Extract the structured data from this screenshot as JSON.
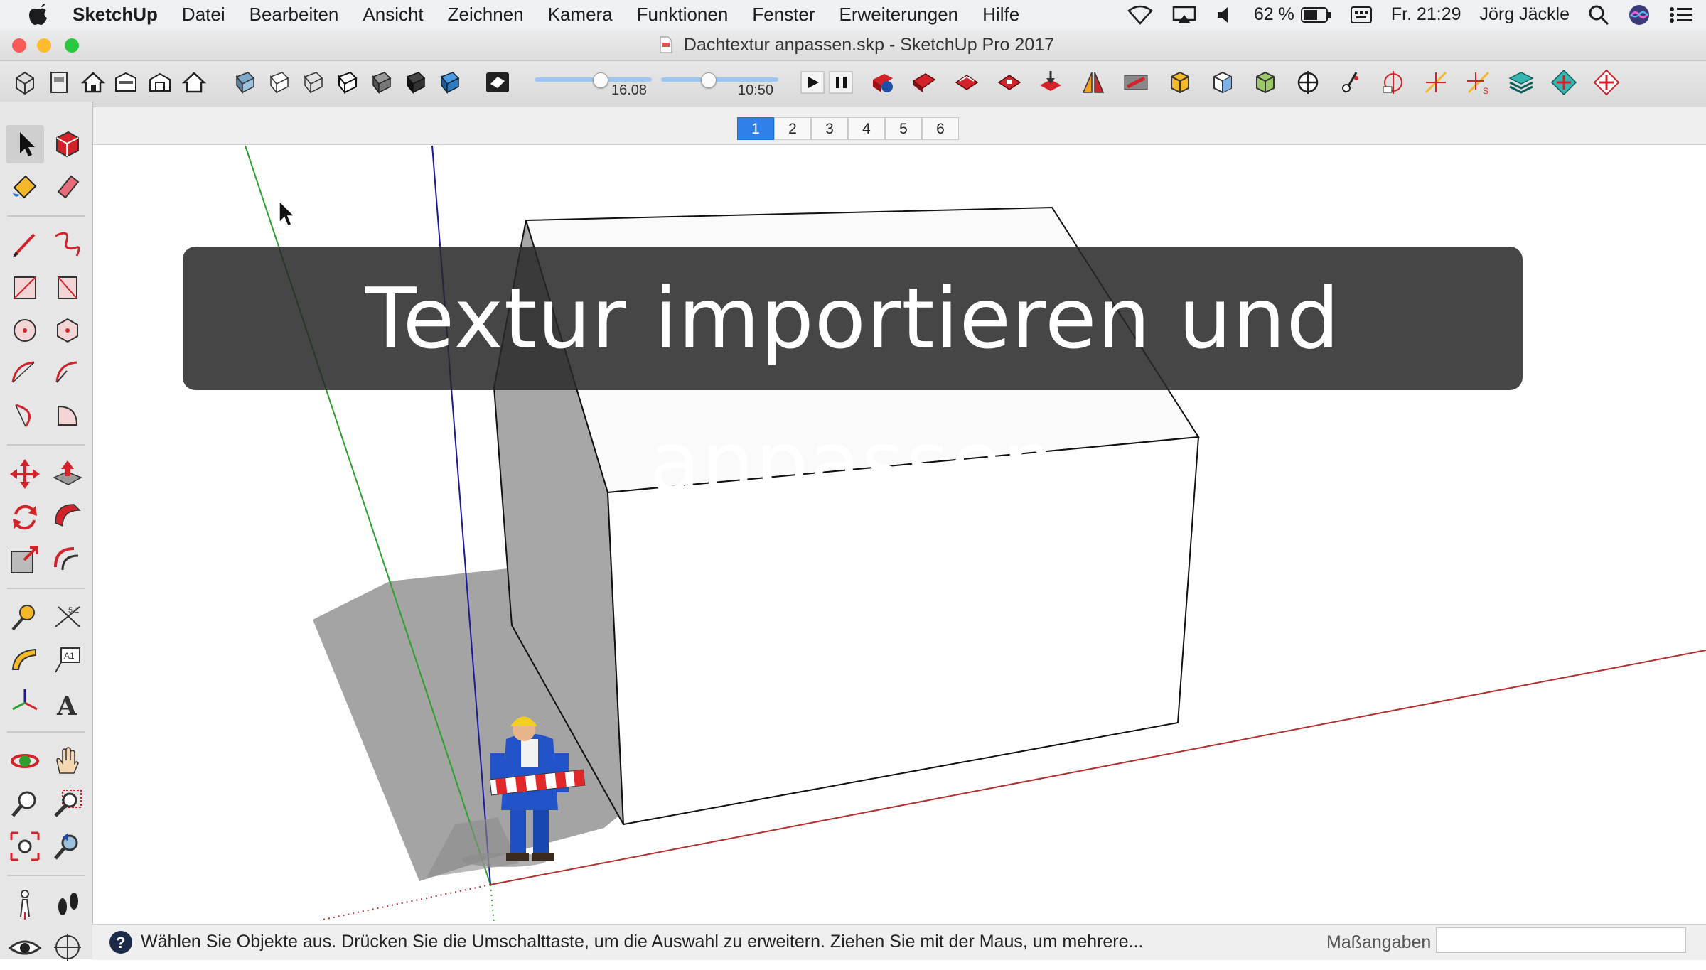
{
  "menubar": {
    "app_name": "SketchUp",
    "menus": [
      "Datei",
      "Bearbeiten",
      "Ansicht",
      "Zeichnen",
      "Kamera",
      "Funktionen",
      "Fenster",
      "Erweiterungen",
      "Hilfe"
    ],
    "battery": "62 %",
    "clock": "Fr. 21:29",
    "user": "Jörg Jäckle"
  },
  "window": {
    "title": "Dachtextur anpassen.skp - SketchUp Pro 2017"
  },
  "toolbar": {
    "date_value": "16.08",
    "time_value": "10:50",
    "date_fraction": 0.56,
    "time_fraction": 0.4
  },
  "scenes": {
    "tabs": [
      "1",
      "2",
      "3",
      "4",
      "5",
      "6"
    ],
    "active": "1"
  },
  "overlay": {
    "caption": "Textur importieren und anpassen"
  },
  "statusbar": {
    "help_text": "Wählen Sie Objekte aus. Drücken Sie die Umschalttaste, um die Auswahl zu erweitern. Ziehen Sie mit der Maus, um mehrere...",
    "measurements_label": "Maßangaben",
    "measurements_value": ""
  },
  "colors": {
    "accent": "#2f80e8",
    "axis_green": "#2e9f2e",
    "axis_blue": "#1a1a9a",
    "axis_red": "#b03030",
    "tool_red": "#d3232a"
  }
}
